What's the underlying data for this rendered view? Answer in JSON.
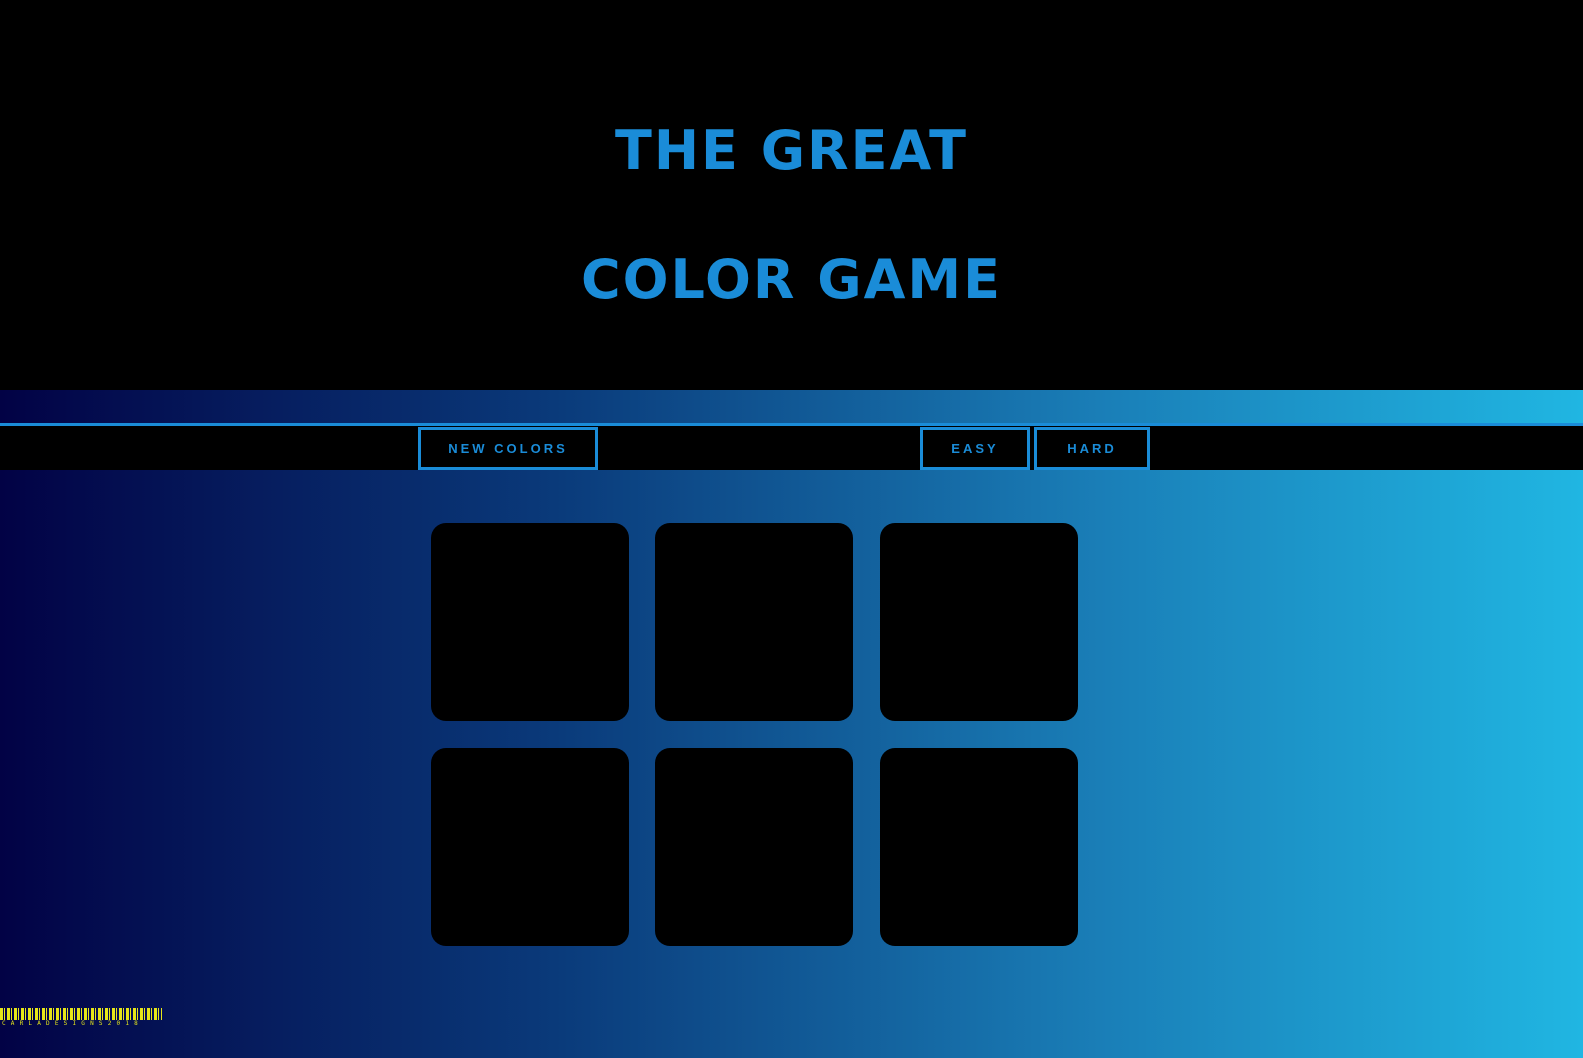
{
  "header": {
    "title_line1": "THE GREAT",
    "title_line2": "COLOR GAME"
  },
  "nav": {
    "new_colors_label": "NEW COLORS",
    "easy_label": "EASY",
    "hard_label": "HARD"
  },
  "squares": [
    {
      "color": "#000000"
    },
    {
      "color": "#000000"
    },
    {
      "color": "#000000"
    },
    {
      "color": "#000000"
    },
    {
      "color": "#000000"
    },
    {
      "color": "#000000"
    }
  ],
  "footer": {
    "logo_text": "CARLADESIGNS2018"
  },
  "colors": {
    "accent": "#1a8cd8",
    "header_bg": "#000000",
    "gradient_start": "#020245",
    "gradient_end": "#20b6e2",
    "logo": "#e6e619"
  }
}
